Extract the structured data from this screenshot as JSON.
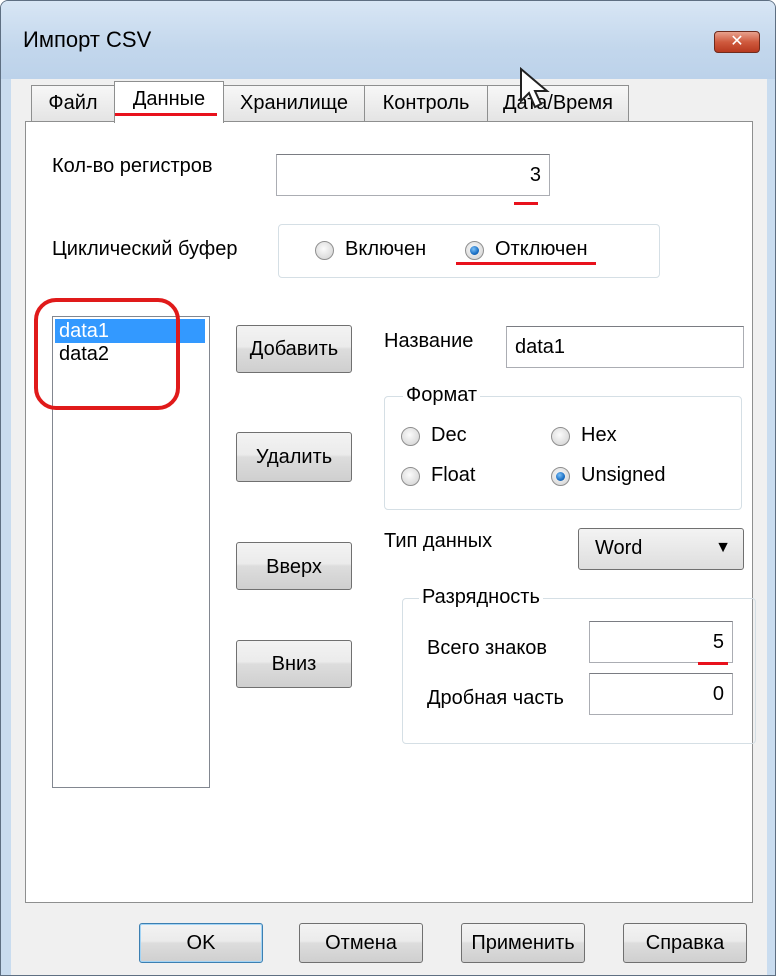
{
  "window": {
    "title": "Импорт CSV",
    "close_glyph": "✕"
  },
  "tabs": [
    {
      "label": "Файл"
    },
    {
      "label": "Данные"
    },
    {
      "label": "Хранилище"
    },
    {
      "label": "Контроль"
    },
    {
      "label": "Дата/Время"
    }
  ],
  "registers": {
    "label": "Кол-во регистров",
    "value": "3"
  },
  "cyclic_buffer": {
    "label": "Циклический буфер",
    "on_label": "Включен",
    "off_label": "Отключен",
    "selected": "off"
  },
  "list": {
    "items": [
      "data1",
      "data2"
    ],
    "selected_index": 0
  },
  "buttons": {
    "add": "Добавить",
    "delete": "Удалить",
    "up": "Вверх",
    "down": "Вниз"
  },
  "name_field": {
    "label": "Название",
    "value": "data1"
  },
  "format": {
    "caption": "Формат",
    "options": [
      "Dec",
      "Hex",
      "Float",
      "Unsigned"
    ],
    "selected": "Unsigned"
  },
  "data_type": {
    "label": "Тип данных",
    "value": "Word",
    "arrow": "▼"
  },
  "digits": {
    "caption": "Разрядность",
    "total_label": "Всего знаков",
    "total_value": "5",
    "fraction_label": "Дробная часть",
    "fraction_value": "0"
  },
  "footer": {
    "ok": "OK",
    "cancel": "Отмена",
    "apply": "Применить",
    "help": "Справка"
  },
  "colors": {
    "annotation": "#e8111c",
    "selection": "#3399ff"
  }
}
